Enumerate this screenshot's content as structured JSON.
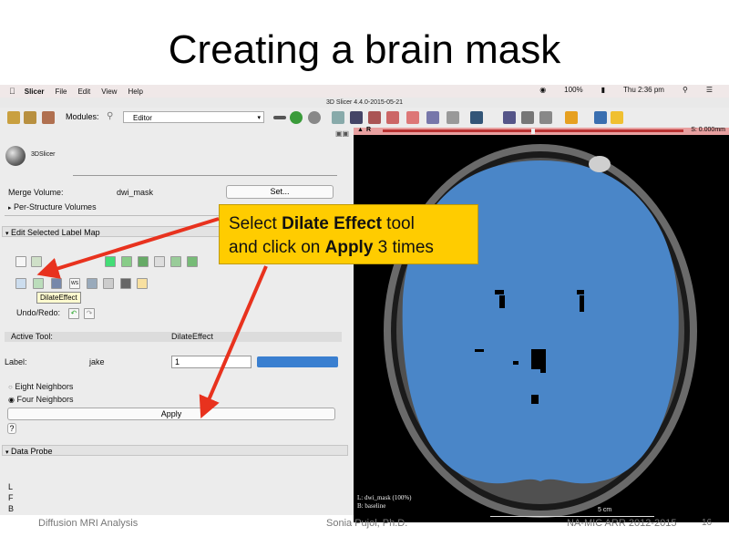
{
  "slide": {
    "title": "Creating a brain mask",
    "footer_left": "Diffusion MRI Analysis",
    "footer_center": "Sonia Pujol, Ph.D.",
    "footer_right": "NA-MIC ARR 2012-2015",
    "page_number": "16"
  },
  "menubar": {
    "app": "Slicer",
    "items": [
      "File",
      "Edit",
      "View",
      "Help"
    ],
    "battery": "100%",
    "clock": "Thu 2:36 pm"
  },
  "window": {
    "title": "3D Slicer 4.4.0-2015-05-21"
  },
  "toolbar": {
    "modules_label": "Modules:",
    "module_value": "Editor"
  },
  "panel": {
    "logo_text": "3DSlicer",
    "merge_volume_label": "Merge Volume:",
    "merge_volume_value": "dwi_mask",
    "set_button": "Set...",
    "per_structure": "Per-Structure Volumes",
    "edit_label_map": "Edit Selected Label Map",
    "tooltip": "DilateEffect",
    "undo_redo": "Undo/Redo:",
    "active_tool_label": "Active Tool:",
    "active_tool_value": "DilateEffect",
    "label_label": "Label:",
    "label_name": "jake",
    "label_value": "1",
    "eight_neighbors": "Eight Neighbors",
    "four_neighbors": "Four Neighbors",
    "apply_button": "Apply",
    "help_button": "?",
    "data_probe": "Data Probe",
    "probe_l": "L",
    "probe_f": "F",
    "probe_b": "B"
  },
  "viewer": {
    "slice_label": "R",
    "slice_offset": "S: 0.000mm",
    "overlay_line1": "L: dwi_mask (100%)",
    "overlay_line2": "B: baseline",
    "scale": "5 cm",
    "mask_color": "#4a86c8"
  },
  "callout": {
    "line1_prefix": "Select ",
    "line1_bold": "Dilate Effect",
    "line1_suffix": " tool",
    "line2_prefix": "and click on ",
    "line2_bold": "Apply",
    "line2_suffix": " 3 times"
  }
}
